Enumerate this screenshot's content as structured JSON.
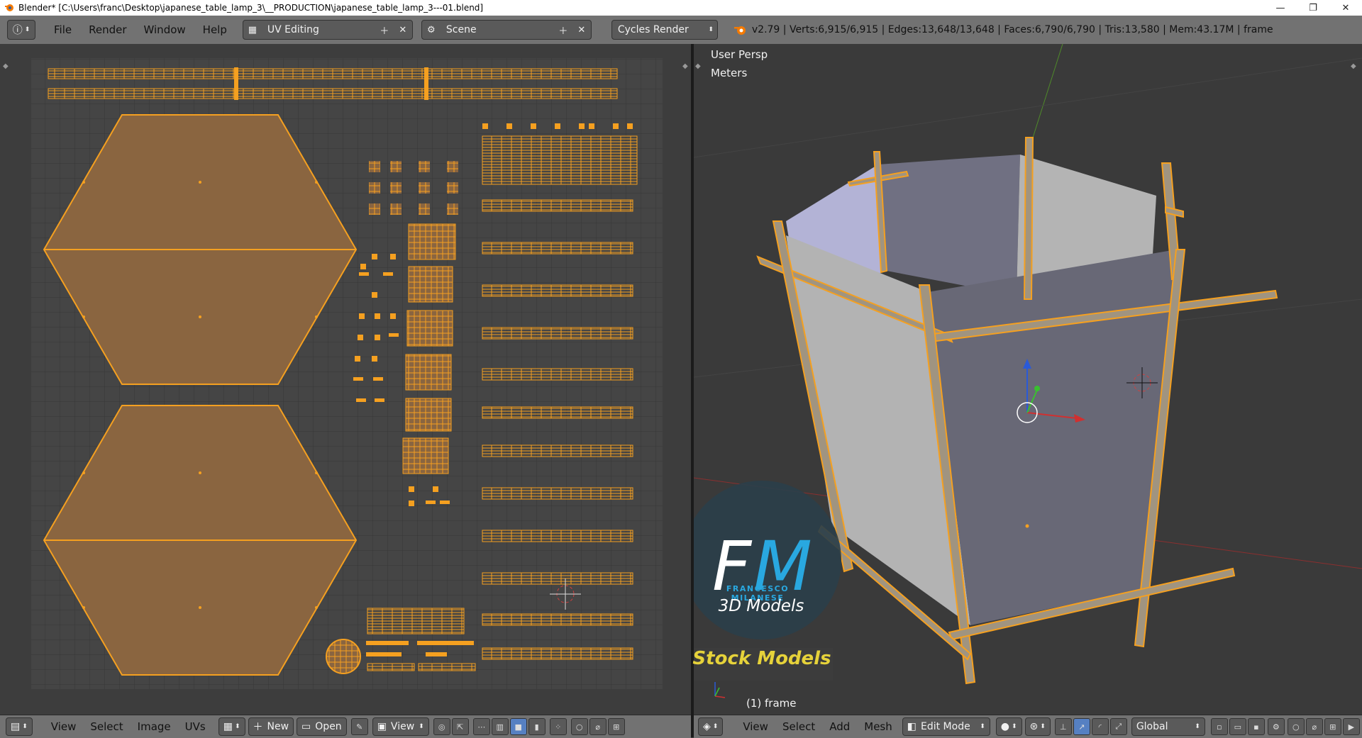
{
  "window": {
    "title": "Blender* [C:\\Users\\franc\\Desktop\\japanese_table_lamp_3\\__PRODUCTION\\japanese_table_lamp_3---01.blend]",
    "minimize": "—",
    "maximize": "❐",
    "close": "✕"
  },
  "topbar": {
    "menus": [
      "File",
      "Render",
      "Window",
      "Help"
    ],
    "layout": "UV Editing",
    "scene": "Scene",
    "engine": "Cycles Render",
    "stats": "v2.79 | Verts:6,915/6,915 | Edges:13,648/13,648 | Faces:6,790/6,790 | Tris:13,580 | Mem:43.17M | frame"
  },
  "uv_editor": {
    "menus": [
      "View",
      "Select",
      "Image",
      "UVs"
    ],
    "new_label": "New",
    "open_label": "Open",
    "view_label": "View"
  },
  "viewport": {
    "persp_label": "User Persp",
    "units_label": "Meters",
    "object_label": "(1) frame",
    "menus": [
      "View",
      "Select",
      "Add",
      "Mesh"
    ],
    "mode": "Edit Mode",
    "orientation": "Global",
    "watermark": {
      "initials": "FM",
      "brand": "FRANCESCO MILANESE",
      "subtitle": "3D Models",
      "banner": "Stock Models"
    }
  },
  "colors": {
    "accent_orange": "#f5a020",
    "uv_fill": "#8a6540",
    "panel_grey": "#3d3d3d",
    "header_grey": "#727272",
    "watermark_blue": "#29a8e0",
    "watermark_yellow": "#e6d23a"
  }
}
